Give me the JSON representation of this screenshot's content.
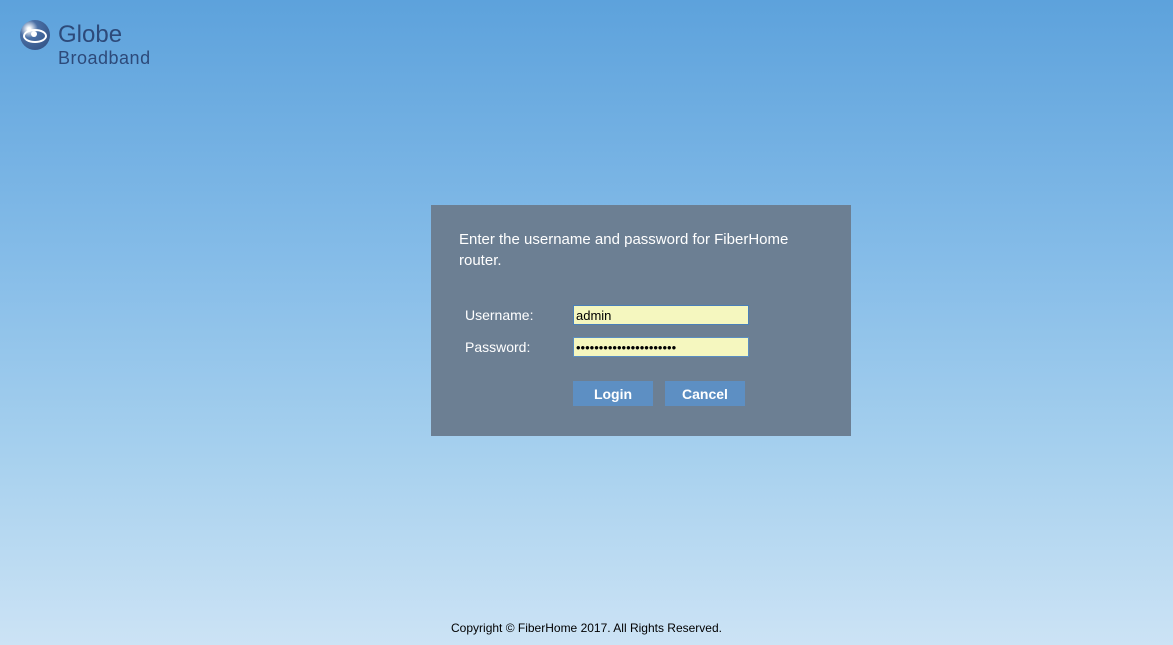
{
  "logo": {
    "brand": "Globe",
    "subtext": "Broadband"
  },
  "login": {
    "instruction": "Enter the username and password for FiberHome router.",
    "username_label": "Username:",
    "username_value": "admin",
    "password_label": "Password:",
    "password_value": "••••••••••••••••••••••",
    "login_button": "Login",
    "cancel_button": "Cancel"
  },
  "footer": {
    "copyright": "Copyright © FiberHome 2017. All Rights Reserved."
  }
}
